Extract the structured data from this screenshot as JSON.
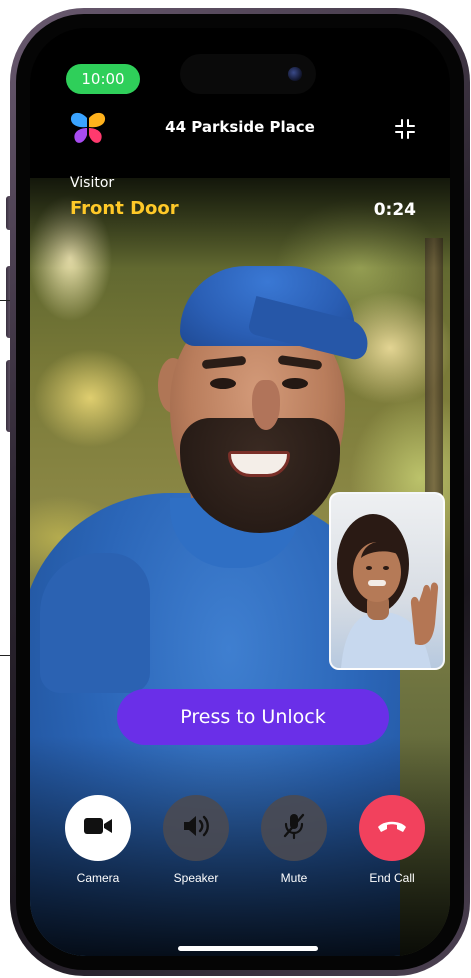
{
  "status_bar": {
    "time": "10:00"
  },
  "header": {
    "logo_icon": "butterfly-logo-icon",
    "address": "44 Parkside Place",
    "collapse_icon": "collapse-icon"
  },
  "call": {
    "visitor_label": "Visitor",
    "door_name": "Front Door",
    "duration": "0:24"
  },
  "unlock": {
    "label": "Press to Unlock"
  },
  "controls": [
    {
      "label": "Camera",
      "icon": "video-camera-icon"
    },
    {
      "label": "Speaker",
      "icon": "speaker-icon"
    },
    {
      "label": "Mute",
      "icon": "microphone-muted-icon"
    },
    {
      "label": "End Call",
      "icon": "end-call-icon"
    }
  ],
  "colors": {
    "time_pill": "#2fcf5a",
    "door_name": "#ffc928",
    "unlock_button": "#6a2fe8",
    "end_call": "#f2415d",
    "control_dark": "#4a4a52"
  }
}
